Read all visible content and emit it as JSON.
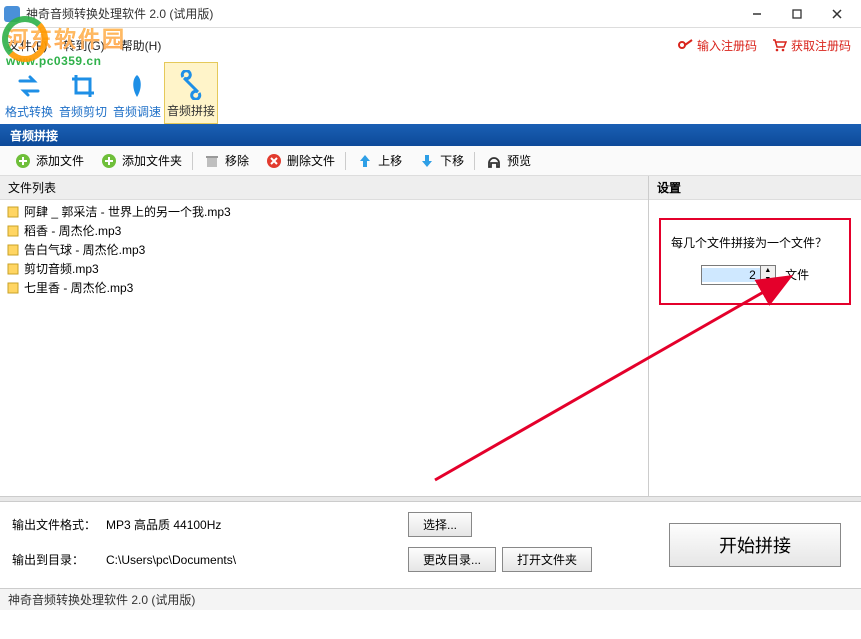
{
  "window": {
    "title": "神奇音频转换处理软件 2.0 (试用版)"
  },
  "watermark": {
    "name": "河东软件园",
    "url": "www.pc0359.cn"
  },
  "menu": {
    "file": "文件(F)",
    "convert": "转到(G)",
    "help": "帮助(H)"
  },
  "rlinks": {
    "enter_code": "输入注册码",
    "get_code": "获取注册码"
  },
  "bigtools": {
    "format": "格式转换",
    "cut": "音频剪切",
    "speed": "音频调速",
    "join": "音频拼接"
  },
  "section": {
    "title": "音频拼接"
  },
  "toolbar": {
    "add_file": "添加文件",
    "add_folder": "添加文件夹",
    "remove": "移除",
    "delete": "删除文件",
    "up": "上移",
    "down": "下移",
    "preview": "预览"
  },
  "filelist": {
    "header": "文件列表",
    "items": [
      "阿肆 _ 郭采洁 - 世界上的另一个我.mp3",
      "稻香 - 周杰伦.mp3",
      "告白气球 - 周杰伦.mp3",
      "剪切音频.mp3",
      "七里香 - 周杰伦.mp3"
    ]
  },
  "settings": {
    "header": "设置",
    "question": "每几个文件拼接为一个文件？",
    "value": "2",
    "unit": "文件"
  },
  "output": {
    "format_label": "输出文件格式：",
    "format_value": "MP3 高品质 44100Hz",
    "choose": "选择...",
    "dir_label": "输出到目录：",
    "dir_value": "C:\\Users\\pc\\Documents\\",
    "change_dir": "更改目录...",
    "open_folder": "打开文件夹"
  },
  "start": {
    "label": "开始拼接"
  },
  "status": {
    "text": "神奇音频转换处理软件 2.0 (试用版)"
  }
}
